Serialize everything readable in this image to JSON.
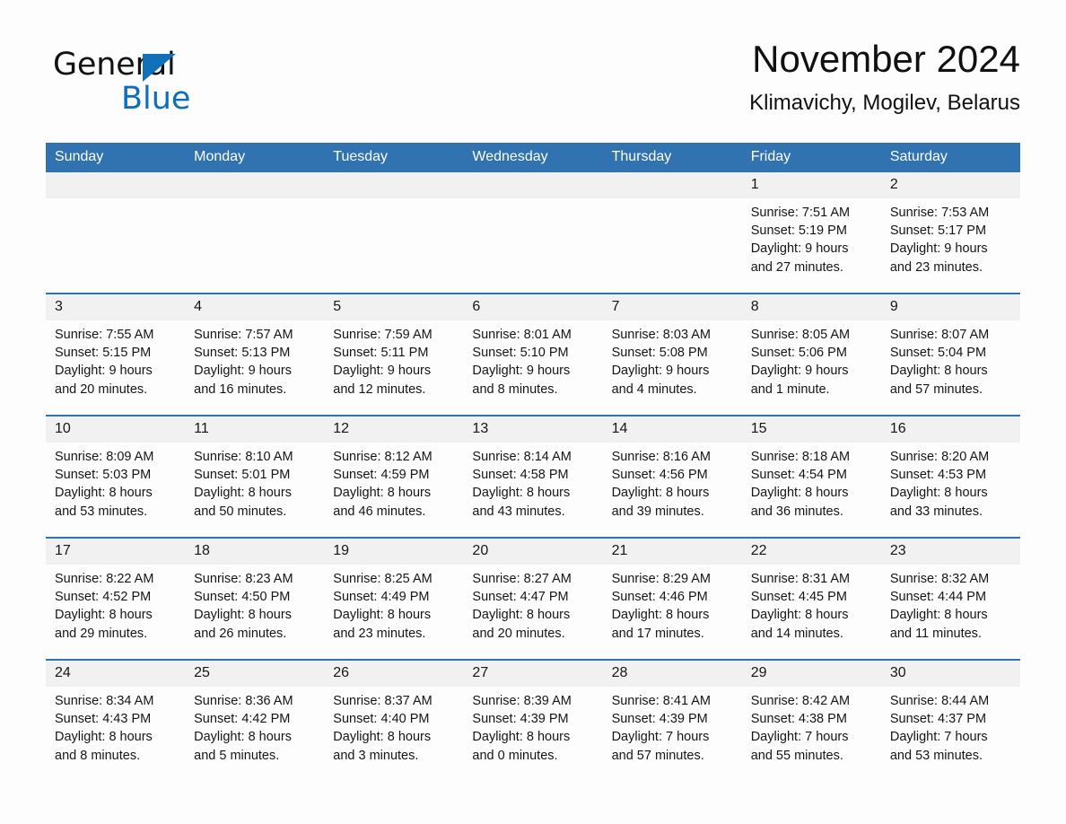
{
  "brand": {
    "name_part1": "General",
    "name_part2": "Blue",
    "triangle_icon": "triangle-icon",
    "accent_color": "#0d6fba"
  },
  "header": {
    "month_title": "November 2024",
    "location": "Klimavichy, Mogilev, Belarus",
    "header_bg_color": "#3172b0",
    "daynum_bg_color": "#f1f1f1"
  },
  "weekday_headers": [
    "Sunday",
    "Monday",
    "Tuesday",
    "Wednesday",
    "Thursday",
    "Friday",
    "Saturday"
  ],
  "labels": {
    "sunrise_prefix": "Sunrise:",
    "sunset_prefix": "Sunset:",
    "daylight_prefix": "Daylight:"
  },
  "weeks": [
    [
      {
        "day": "",
        "empty": true
      },
      {
        "day": "",
        "empty": true
      },
      {
        "day": "",
        "empty": true
      },
      {
        "day": "",
        "empty": true
      },
      {
        "day": "",
        "empty": true
      },
      {
        "day": "1",
        "sunrise": "Sunrise: 7:51 AM",
        "sunset": "Sunset: 5:19 PM",
        "daylight_line1": "Daylight: 9 hours",
        "daylight_line2": "and 27 minutes."
      },
      {
        "day": "2",
        "sunrise": "Sunrise: 7:53 AM",
        "sunset": "Sunset: 5:17 PM",
        "daylight_line1": "Daylight: 9 hours",
        "daylight_line2": "and 23 minutes."
      }
    ],
    [
      {
        "day": "3",
        "sunrise": "Sunrise: 7:55 AM",
        "sunset": "Sunset: 5:15 PM",
        "daylight_line1": "Daylight: 9 hours",
        "daylight_line2": "and 20 minutes."
      },
      {
        "day": "4",
        "sunrise": "Sunrise: 7:57 AM",
        "sunset": "Sunset: 5:13 PM",
        "daylight_line1": "Daylight: 9 hours",
        "daylight_line2": "and 16 minutes."
      },
      {
        "day": "5",
        "sunrise": "Sunrise: 7:59 AM",
        "sunset": "Sunset: 5:11 PM",
        "daylight_line1": "Daylight: 9 hours",
        "daylight_line2": "and 12 minutes."
      },
      {
        "day": "6",
        "sunrise": "Sunrise: 8:01 AM",
        "sunset": "Sunset: 5:10 PM",
        "daylight_line1": "Daylight: 9 hours",
        "daylight_line2": "and 8 minutes."
      },
      {
        "day": "7",
        "sunrise": "Sunrise: 8:03 AM",
        "sunset": "Sunset: 5:08 PM",
        "daylight_line1": "Daylight: 9 hours",
        "daylight_line2": "and 4 minutes."
      },
      {
        "day": "8",
        "sunrise": "Sunrise: 8:05 AM",
        "sunset": "Sunset: 5:06 PM",
        "daylight_line1": "Daylight: 9 hours",
        "daylight_line2": "and 1 minute."
      },
      {
        "day": "9",
        "sunrise": "Sunrise: 8:07 AM",
        "sunset": "Sunset: 5:04 PM",
        "daylight_line1": "Daylight: 8 hours",
        "daylight_line2": "and 57 minutes."
      }
    ],
    [
      {
        "day": "10",
        "sunrise": "Sunrise: 8:09 AM",
        "sunset": "Sunset: 5:03 PM",
        "daylight_line1": "Daylight: 8 hours",
        "daylight_line2": "and 53 minutes."
      },
      {
        "day": "11",
        "sunrise": "Sunrise: 8:10 AM",
        "sunset": "Sunset: 5:01 PM",
        "daylight_line1": "Daylight: 8 hours",
        "daylight_line2": "and 50 minutes."
      },
      {
        "day": "12",
        "sunrise": "Sunrise: 8:12 AM",
        "sunset": "Sunset: 4:59 PM",
        "daylight_line1": "Daylight: 8 hours",
        "daylight_line2": "and 46 minutes."
      },
      {
        "day": "13",
        "sunrise": "Sunrise: 8:14 AM",
        "sunset": "Sunset: 4:58 PM",
        "daylight_line1": "Daylight: 8 hours",
        "daylight_line2": "and 43 minutes."
      },
      {
        "day": "14",
        "sunrise": "Sunrise: 8:16 AM",
        "sunset": "Sunset: 4:56 PM",
        "daylight_line1": "Daylight: 8 hours",
        "daylight_line2": "and 39 minutes."
      },
      {
        "day": "15",
        "sunrise": "Sunrise: 8:18 AM",
        "sunset": "Sunset: 4:54 PM",
        "daylight_line1": "Daylight: 8 hours",
        "daylight_line2": "and 36 minutes."
      },
      {
        "day": "16",
        "sunrise": "Sunrise: 8:20 AM",
        "sunset": "Sunset: 4:53 PM",
        "daylight_line1": "Daylight: 8 hours",
        "daylight_line2": "and 33 minutes."
      }
    ],
    [
      {
        "day": "17",
        "sunrise": "Sunrise: 8:22 AM",
        "sunset": "Sunset: 4:52 PM",
        "daylight_line1": "Daylight: 8 hours",
        "daylight_line2": "and 29 minutes."
      },
      {
        "day": "18",
        "sunrise": "Sunrise: 8:23 AM",
        "sunset": "Sunset: 4:50 PM",
        "daylight_line1": "Daylight: 8 hours",
        "daylight_line2": "and 26 minutes."
      },
      {
        "day": "19",
        "sunrise": "Sunrise: 8:25 AM",
        "sunset": "Sunset: 4:49 PM",
        "daylight_line1": "Daylight: 8 hours",
        "daylight_line2": "and 23 minutes."
      },
      {
        "day": "20",
        "sunrise": "Sunrise: 8:27 AM",
        "sunset": "Sunset: 4:47 PM",
        "daylight_line1": "Daylight: 8 hours",
        "daylight_line2": "and 20 minutes."
      },
      {
        "day": "21",
        "sunrise": "Sunrise: 8:29 AM",
        "sunset": "Sunset: 4:46 PM",
        "daylight_line1": "Daylight: 8 hours",
        "daylight_line2": "and 17 minutes."
      },
      {
        "day": "22",
        "sunrise": "Sunrise: 8:31 AM",
        "sunset": "Sunset: 4:45 PM",
        "daylight_line1": "Daylight: 8 hours",
        "daylight_line2": "and 14 minutes."
      },
      {
        "day": "23",
        "sunrise": "Sunrise: 8:32 AM",
        "sunset": "Sunset: 4:44 PM",
        "daylight_line1": "Daylight: 8 hours",
        "daylight_line2": "and 11 minutes."
      }
    ],
    [
      {
        "day": "24",
        "sunrise": "Sunrise: 8:34 AM",
        "sunset": "Sunset: 4:43 PM",
        "daylight_line1": "Daylight: 8 hours",
        "daylight_line2": "and 8 minutes."
      },
      {
        "day": "25",
        "sunrise": "Sunrise: 8:36 AM",
        "sunset": "Sunset: 4:42 PM",
        "daylight_line1": "Daylight: 8 hours",
        "daylight_line2": "and 5 minutes."
      },
      {
        "day": "26",
        "sunrise": "Sunrise: 8:37 AM",
        "sunset": "Sunset: 4:40 PM",
        "daylight_line1": "Daylight: 8 hours",
        "daylight_line2": "and 3 minutes."
      },
      {
        "day": "27",
        "sunrise": "Sunrise: 8:39 AM",
        "sunset": "Sunset: 4:39 PM",
        "daylight_line1": "Daylight: 8 hours",
        "daylight_line2": "and 0 minutes."
      },
      {
        "day": "28",
        "sunrise": "Sunrise: 8:41 AM",
        "sunset": "Sunset: 4:39 PM",
        "daylight_line1": "Daylight: 7 hours",
        "daylight_line2": "and 57 minutes."
      },
      {
        "day": "29",
        "sunrise": "Sunrise: 8:42 AM",
        "sunset": "Sunset: 4:38 PM",
        "daylight_line1": "Daylight: 7 hours",
        "daylight_line2": "and 55 minutes."
      },
      {
        "day": "30",
        "sunrise": "Sunrise: 8:44 AM",
        "sunset": "Sunset: 4:37 PM",
        "daylight_line1": "Daylight: 7 hours",
        "daylight_line2": "and 53 minutes."
      }
    ]
  ]
}
